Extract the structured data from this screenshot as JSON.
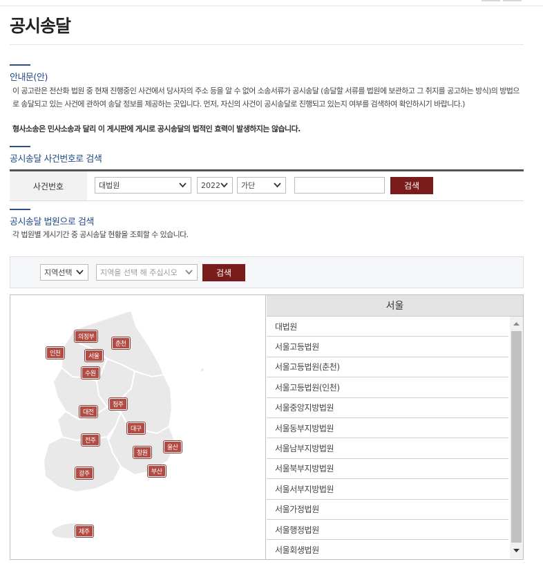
{
  "page": {
    "title": "공시송달"
  },
  "notice": {
    "title": "안내문(안)",
    "text": "이 공고란은 전산화 법원 중 현재 진행중인 사건에서 당사자의 주소 등을 알 수 없어 소송서류가 공시송달 (송달할 서류를 법원에 보관하고 그 취지를 공고하는 방식)의 방법으로 송달되고 있는 사건에 관하여 송달 정보를 제공하는 곳입니다. 먼저, 자신의 사건이 공시송달로 진행되고 있는지 여부를 검색하여 확인하시기 바랍니다.)",
    "bold": "형사소송은 민사소송과 달리 이 게시판에 게시로 공시송달의 법적인 효력이 발생하지는 않습니다."
  },
  "case_search": {
    "title": "공시송달 사건번호로 검색",
    "label": "사건번호",
    "court_select": "대법원",
    "year_select": "2022",
    "type_select": "가단",
    "number_value": "",
    "search_button": "검색"
  },
  "court_search": {
    "title": "공시송달 법원으로 검색",
    "desc": "각 법원별 게시기간 중 공시송달 현황을 조회할 수 있습니다.",
    "region_select": "지역선택",
    "court_placeholder": "지역을 선택 해 주십시오",
    "search_button": "검색"
  },
  "map": {
    "labels": [
      "의정부",
      "춘천",
      "인천",
      "서울",
      "수원",
      "청주",
      "대전",
      "대구",
      "전주",
      "울산",
      "창원",
      "부산",
      "광주",
      "제주"
    ]
  },
  "court_list": {
    "region": "서울",
    "items": [
      "대법원",
      "서울고등법원",
      "서울고등법원(춘천)",
      "서울고등법원(인천)",
      "서울중앙지방법원",
      "서울동부지방법원",
      "서울남부지방법원",
      "서울북부지방법원",
      "서울서부지방법원",
      "서울가정법원",
      "서울행정법원",
      "서울회생법원"
    ]
  },
  "colors": {
    "accent": "#1f4a86",
    "button": "#7b1c1c",
    "map_label": "#b24b44"
  }
}
